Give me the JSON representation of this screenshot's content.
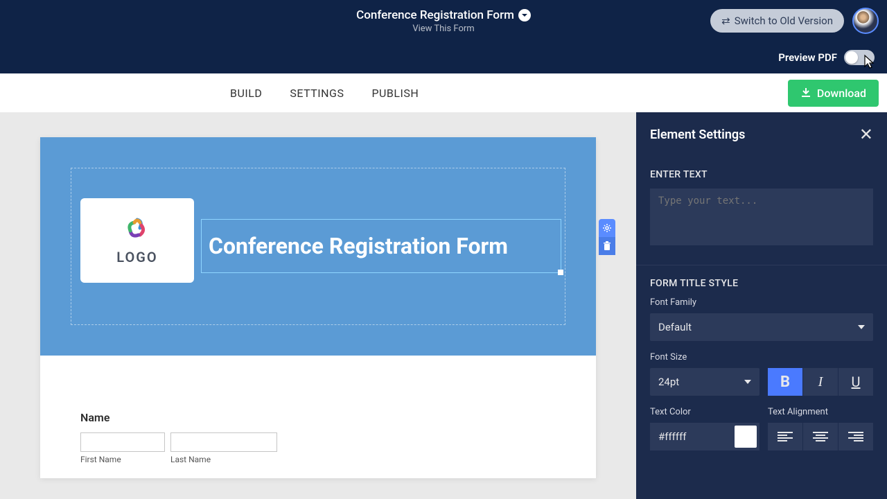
{
  "header": {
    "title": "Conference Registration Form",
    "subtitle": "View This Form",
    "switch_label": "Switch to Old Version"
  },
  "preview": {
    "label": "Preview PDF"
  },
  "nav": {
    "tabs": [
      "BUILD",
      "SETTINGS",
      "PUBLISH"
    ],
    "download": "Download"
  },
  "canvas": {
    "logo_text": "LOGO",
    "form_title": "Conference Registration Form",
    "name_section": {
      "label": "Name",
      "first": "First Name",
      "last": "Last Name"
    }
  },
  "sidebar": {
    "title": "Element Settings",
    "enter_text": {
      "label": "ENTER TEXT",
      "placeholder": "Type your text..."
    },
    "style": {
      "label": "FORM TITLE STYLE",
      "font_family": {
        "label": "Font Family",
        "value": "Default"
      },
      "font_size": {
        "label": "Font Size",
        "value": "24pt"
      },
      "bold": "B",
      "italic": "I",
      "underline": "U",
      "text_color": {
        "label": "Text Color",
        "value": "#ffffff"
      },
      "alignment": {
        "label": "Text Alignment"
      }
    }
  }
}
